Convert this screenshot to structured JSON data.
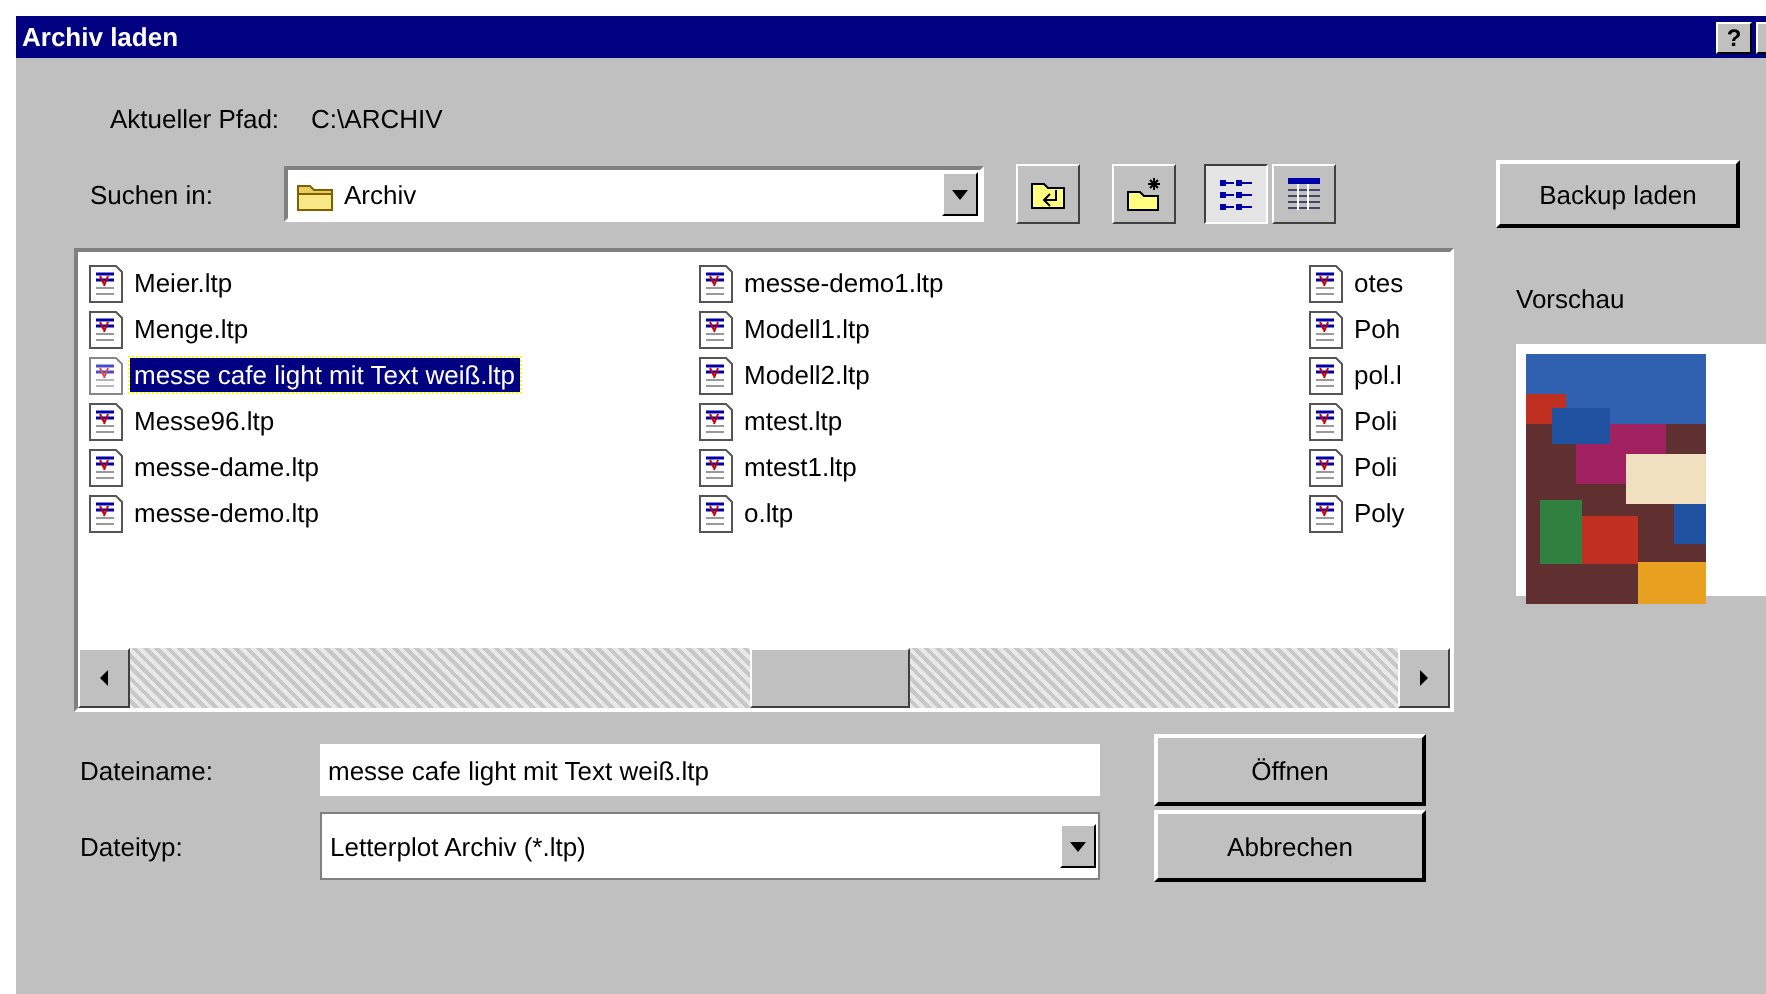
{
  "window": {
    "title": "Archiv laden",
    "help_button": "?"
  },
  "current_path": {
    "label": "Aktueller Pfad:",
    "value": "C:\\ARCHIV"
  },
  "look_in": {
    "label": "Suchen in:",
    "value": "Archiv"
  },
  "toolbar": [
    {
      "kind": "up-folder",
      "selected": false
    },
    {
      "kind": "new-folder",
      "selected": false
    },
    {
      "kind": "list-view",
      "selected": true
    },
    {
      "kind": "details-view",
      "selected": false
    }
  ],
  "backup_button": "Backup laden",
  "preview": {
    "label": "Vorschau"
  },
  "files": [
    {
      "name": "Meier.ltp",
      "selected": false
    },
    {
      "name": "Menge.ltp",
      "selected": false
    },
    {
      "name": "messe cafe light mit Text weiß.ltp",
      "selected": true
    },
    {
      "name": "Messe96.ltp",
      "selected": false
    },
    {
      "name": "messe-dame.ltp",
      "selected": false
    },
    {
      "name": "messe-demo.ltp",
      "selected": false
    },
    {
      "name": "messe-demo1.ltp",
      "selected": false
    },
    {
      "name": "Modell1.ltp",
      "selected": false
    },
    {
      "name": "Modell2.ltp",
      "selected": false
    },
    {
      "name": "mtest.ltp",
      "selected": false
    },
    {
      "name": "mtest1.ltp",
      "selected": false
    },
    {
      "name": "o.ltp",
      "selected": false
    },
    {
      "name": "otes",
      "selected": false
    },
    {
      "name": "Poh",
      "selected": false
    },
    {
      "name": "pol.l",
      "selected": false
    },
    {
      "name": "Poli",
      "selected": false
    },
    {
      "name": "Poli",
      "selected": false
    },
    {
      "name": "Poly",
      "selected": false
    }
  ],
  "file_name": {
    "label": "Dateiname:",
    "value": "messe cafe light mit Text weiß.ltp"
  },
  "file_type": {
    "label": "Dateityp:",
    "value": "Letterplot Archiv (*.ltp)"
  },
  "buttons": [
    "Öffnen",
    "Abbrechen"
  ]
}
